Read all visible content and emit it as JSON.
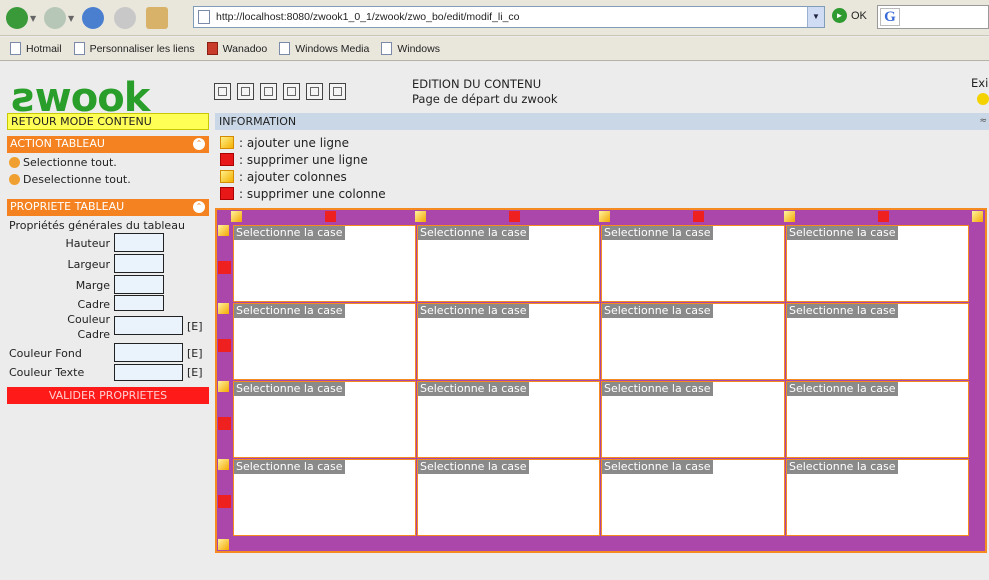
{
  "browser": {
    "address": "http://localhost:8080/zwook1_0_1/zwook/zwo_bo/edit/modif_li_co",
    "go_label": "OK",
    "links": [
      "Hotmail",
      "Personnaliser les liens",
      "Wanadoo",
      "Windows Media",
      "Windows"
    ]
  },
  "app": {
    "logo": "ƨwook",
    "header_title": "EDITION DU CONTENU",
    "header_subtitle": "Page de départ du zwook",
    "exit_label": "Exi"
  },
  "left": {
    "retour": "RETOUR MODE CONTENU",
    "action_header": "ACTION TABLEAU",
    "select_all": "Selectionne tout.",
    "deselect_all": "Deselectionne tout.",
    "prop_header": "PROPRIETE TABLEAU",
    "prop_title": "Propriétés générales du tableau",
    "hauteur": "Hauteur",
    "largeur": "Largeur",
    "marge": "Marge",
    "cadre": "Cadre",
    "couleur_cadre_1": "Couleur",
    "couleur_cadre_2": "Cadre",
    "couleur_fond": "Couleur Fond",
    "couleur_texte": "Couleur Texte",
    "e_tag": "[E]",
    "valider": "VALIDER PROPRIETES"
  },
  "info": {
    "header": "INFORMATION",
    "collapse": "≈",
    "legend": [
      {
        "kind": "add",
        "text": ": ajouter une ligne"
      },
      {
        "kind": "del",
        "text": ": supprimer une ligne"
      },
      {
        "kind": "add",
        "text": ": ajouter colonnes"
      },
      {
        "kind": "del",
        "text": ": supprimer une colonne"
      }
    ]
  },
  "grid": {
    "rows": 4,
    "cols": 4,
    "cell_label": "Selectionne la case"
  },
  "colors": {
    "accent_orange": "#f48220",
    "table_purple": "#ab46ab",
    "logo_green": "#2a9e2a"
  }
}
